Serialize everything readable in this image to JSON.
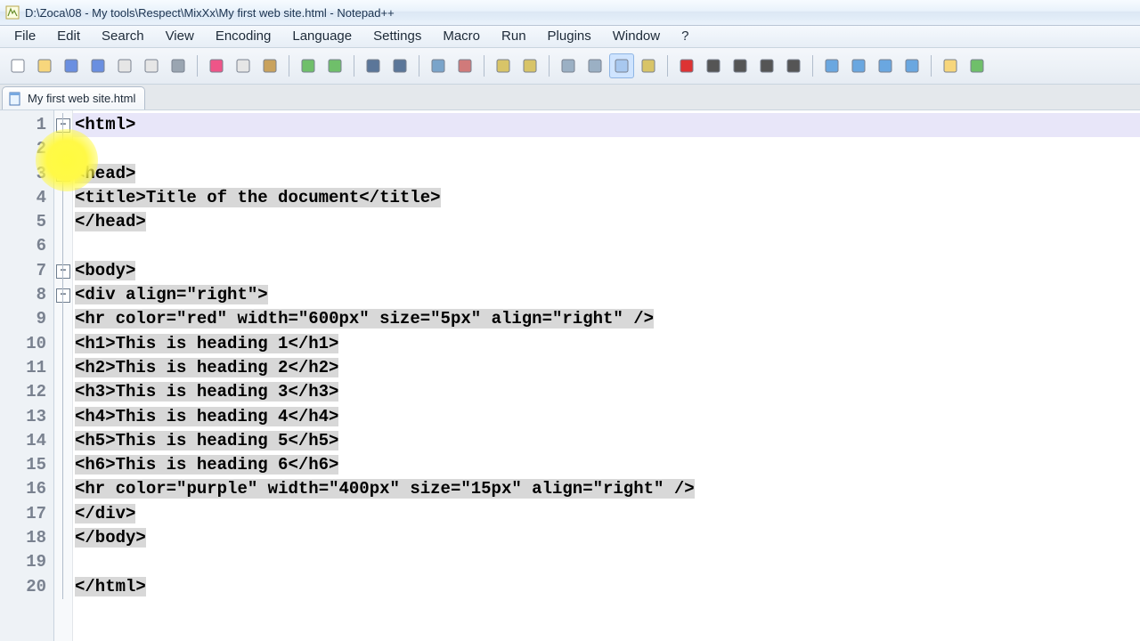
{
  "window_title": "D:\\Zoca\\08 - My tools\\Respect\\MixXx\\My first web site.html - Notepad++",
  "menu": [
    "File",
    "Edit",
    "Search",
    "View",
    "Encoding",
    "Language",
    "Settings",
    "Macro",
    "Run",
    "Plugins",
    "Window",
    "?"
  ],
  "tab": {
    "label": "My first web site.html"
  },
  "toolbar_icons": [
    "new-file-icon",
    "open-file-icon",
    "save-icon",
    "save-all-icon",
    "copy-file-icon",
    "paste-file-icon",
    "print-icon",
    "sep",
    "cut-icon",
    "copy-icon",
    "paste-icon",
    "sep",
    "undo-icon",
    "redo-icon",
    "sep",
    "find-icon",
    "replace-icon",
    "sep",
    "zoom-in-icon",
    "zoom-out-icon",
    "sep",
    "word-wrap-icon",
    "show-all-chars-icon",
    "sep",
    "indent-guide-icon",
    "pilcrow-icon",
    "doc-map-icon",
    "function-list-icon",
    "sep",
    "record-icon",
    "stop-icon",
    "play-icon",
    "play-fast-icon",
    "save-macro-icon",
    "sep",
    "collapse-all-icon",
    "uncollapse-level-icon",
    "collapse-level-icon",
    "expand-all-icon",
    "sep",
    "folder-icon",
    "spellcheck-icon"
  ],
  "code_lines": [
    {
      "n": 1,
      "fold": "minus",
      "html": "<span class='tag'>&lt;html&gt;</span>",
      "cls": "currentline"
    },
    {
      "n": 2,
      "html": ""
    },
    {
      "n": 3,
      "fold": "minus",
      "html": "<span class='sel'><span class='tag'>&lt;head&gt;</span></span>"
    },
    {
      "n": 4,
      "html": "<span class='sel'><span class='tag'>&lt;title&gt;</span><span class='txt'>Title of the document</span><span class='tag'>&lt;/title&gt;</span></span>"
    },
    {
      "n": 5,
      "html": "<span class='sel'><span class='tag'>&lt;/head&gt;</span></span>"
    },
    {
      "n": 6,
      "html": ""
    },
    {
      "n": 7,
      "fold": "minus",
      "html": "<span class='sel'><span class='tag'>&lt;body&gt;</span></span>"
    },
    {
      "n": 8,
      "fold": "minus",
      "html": "<span class='sel'><span class='tag'>&lt;div</span> <span class='attr'>align</span>=<span class='val'>\"right\"</span><span class='tag'>&gt;</span></span>"
    },
    {
      "n": 9,
      "html": "<span class='sel'><span class='tag'>&lt;hr</span> <span class='attr'>color</span>=<span class='val'>\"red\"</span> <span class='attr'>width</span>=<span class='val'>\"600px\"</span> <span class='attr'>size</span>=<span class='val'>\"5px\"</span> <span class='attr'>align</span>=<span class='val'>\"right\"</span> <span class='tag'>/&gt;</span></span>"
    },
    {
      "n": 10,
      "html": "<span class='sel'><span class='tag'>&lt;h1&gt;</span><span class='txt'>This is heading 1</span><span class='tag'>&lt;/h1&gt;</span></span>"
    },
    {
      "n": 11,
      "html": "<span class='sel'><span class='tag'>&lt;h2&gt;</span><span class='txt'>This is heading 2</span><span class='tag'>&lt;/h2&gt;</span></span>"
    },
    {
      "n": 12,
      "html": "<span class='sel'><span class='tag'>&lt;h3&gt;</span><span class='txt'>This is heading 3</span><span class='tag'>&lt;/h3&gt;</span></span>"
    },
    {
      "n": 13,
      "html": "<span class='sel'><span class='tag'>&lt;h4&gt;</span><span class='txt'>This is heading 4</span><span class='tag'>&lt;/h4&gt;</span></span>"
    },
    {
      "n": 14,
      "html": "<span class='sel'><span class='tag'>&lt;h5&gt;</span><span class='txt'>This is heading 5</span><span class='tag'>&lt;/h5&gt;</span></span>"
    },
    {
      "n": 15,
      "html": "<span class='sel'><span class='tag'>&lt;h6&gt;</span><span class='txt'>This is heading 6</span><span class='tag'>&lt;/h6&gt;</span></span>"
    },
    {
      "n": 16,
      "html": "<span class='sel'><span class='tag'>&lt;hr</span> <span class='attr'>color</span>=<span class='val'>\"purple\"</span> <span class='attr'>width</span>=<span class='val'>\"400px\"</span> <span class='attr'>size</span>=<span class='val'>\"15px\"</span> <span class='attr'>align</span>=<span class='val'>\"right\"</span> <span class='tag'>/&gt;</span></span>"
    },
    {
      "n": 17,
      "html": "<span class='sel'><span class='tag'>&lt;/div&gt;</span></span>"
    },
    {
      "n": 18,
      "html": "<span class='sel'><span class='tag'>&lt;/body&gt;</span></span>"
    },
    {
      "n": 19,
      "html": ""
    },
    {
      "n": 20,
      "html": "<span class='sel'><span class='tag'>&lt;/html&gt;</span></span>"
    }
  ]
}
